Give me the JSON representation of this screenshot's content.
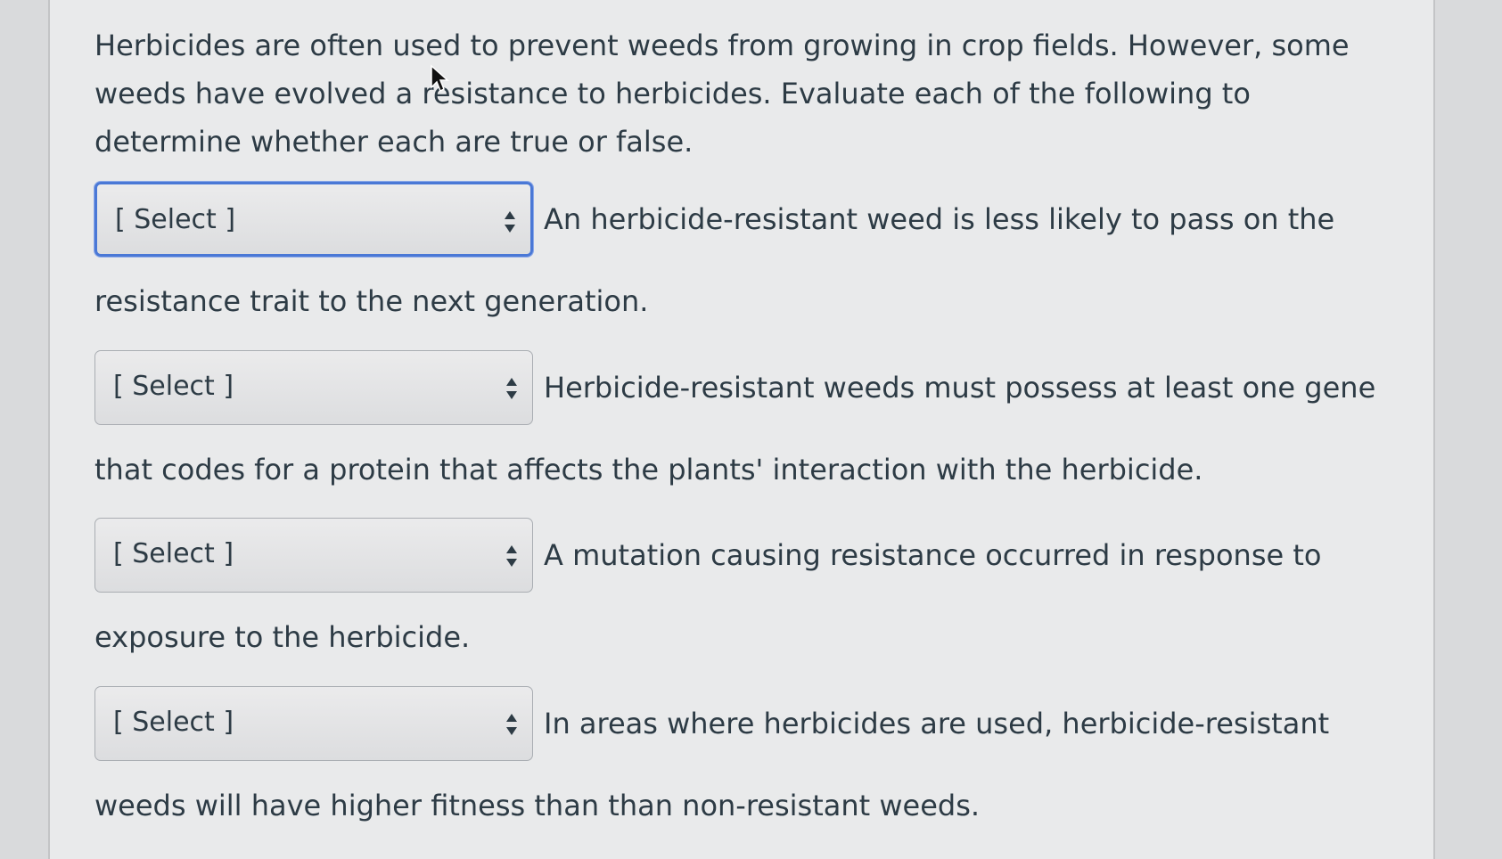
{
  "intro": "Herbicides are often used to prevent weeds from growing in crop fields. However, some weeds have evolved a resistance to herbicides. Evaluate each of the following to determine whether each are true or false.",
  "questions": [
    {
      "select_label": "[ Select ]",
      "text_inline": "An herbicide-resistant weed is less likely to pass on the",
      "text_cont": "resistance trait to the next generation."
    },
    {
      "select_label": "[ Select ]",
      "text_inline": "Herbicide-resistant weeds must possess at least one gene",
      "text_cont": "that codes for a protein that affects the plants' interaction with the herbicide."
    },
    {
      "select_label": "[ Select ]",
      "text_inline": "A mutation causing resistance occurred in response to",
      "text_cont": "exposure to the herbicide."
    },
    {
      "select_label": "[ Select ]",
      "text_inline": "In areas where herbicides are used, herbicide-resistant",
      "text_cont": "weeds will have higher fitness than than non-resistant weeds."
    }
  ],
  "icons": {
    "select_arrow": "up-down-arrows-icon",
    "cursor": "mouse-pointer-icon"
  },
  "colors": {
    "focus_border": "#4a78d6",
    "text": "#2d3b45"
  }
}
